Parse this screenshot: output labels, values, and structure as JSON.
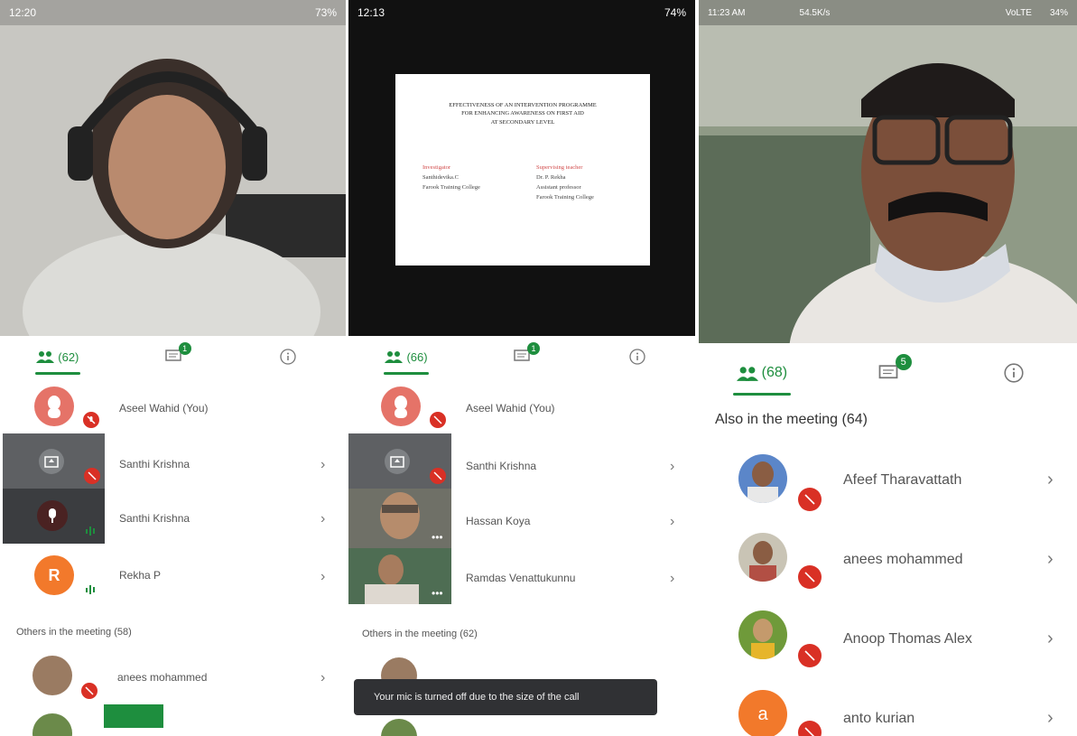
{
  "panels": [
    {
      "status": {
        "time": "12:20",
        "battery": "73%"
      },
      "tabs": {
        "people_count": "(62)",
        "chat_badge": "1"
      },
      "participants": [
        {
          "name": "Aseel Wahid (You)"
        },
        {
          "name": "Santhi Krishna"
        },
        {
          "name": "Santhi Krishna"
        },
        {
          "name": "Rekha P",
          "initial": "R"
        }
      ],
      "section_title": "Others in the meeting (58)",
      "others": [
        {
          "name": "anees mohammed"
        }
      ]
    },
    {
      "status": {
        "time": "12:13",
        "battery": "74%"
      },
      "tabs": {
        "people_count": "(66)",
        "chat_badge": "1"
      },
      "slide": {
        "title_lines": [
          "EFFECTIVENESS OF AN INTERVENTION PROGRAMME",
          "FOR ENHANCING AWARENESS ON FIRST AID",
          "AT SECONDARY LEVEL"
        ],
        "left": {
          "label": "Investigator",
          "lines": [
            "Santhidevika.C",
            "Farook Training College"
          ]
        },
        "right": {
          "label": "Supervising teacher",
          "lines": [
            "Dr. P. Rekha",
            "Assistant professor",
            "Farook Training College"
          ]
        }
      },
      "participants": [
        {
          "name": "Aseel Wahid (You)"
        },
        {
          "name": "Santhi Krishna"
        },
        {
          "name": "Hassan Koya"
        },
        {
          "name": "Ramdas Venattukunnu"
        }
      ],
      "section_title": "Others in the meeting (62)",
      "toast": "Your mic is turned off due to the size of the call"
    },
    {
      "status": {
        "time": "11:23 AM",
        "net": "54.5K/s",
        "signal": "VoLTE",
        "battery": "34%"
      },
      "tabs": {
        "people_count": "(68)",
        "chat_badge": "5"
      },
      "section_title": "Also in the meeting (64)",
      "participants": [
        {
          "name": "Afeef Tharavattath"
        },
        {
          "name": "anees mohammed"
        },
        {
          "name": "Anoop Thomas Alex"
        },
        {
          "name": "anto kurian",
          "initial": "a"
        }
      ]
    }
  ],
  "colors": {
    "accent": "#1e8e3e",
    "mic_off": "#d93025",
    "toast_bg": "#303134"
  },
  "icons": [
    "people-icon",
    "chat-icon",
    "info-icon",
    "mic-off-icon",
    "present-icon",
    "chevron-right-icon",
    "sound-bars-icon"
  ]
}
